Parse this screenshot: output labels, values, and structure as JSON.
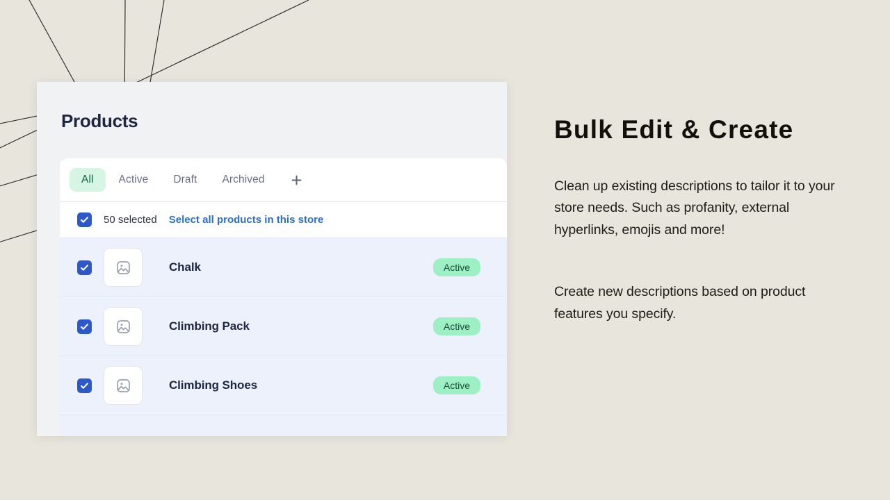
{
  "theme": {
    "page_background": "#e8e5dd",
    "card_background": "#f1f2f4",
    "panel_background": "#ffffff",
    "accent_blue": "#2c6ecb",
    "checkbox_blue": "#2c58c9",
    "badge_green_bg": "#9df0c4",
    "badge_green_text": "#1d4c3b",
    "tab_active_bg": "#d7f5e3",
    "tab_active_text": "#0e6245",
    "row_selected_bg": "#edf1fb",
    "heading_color": "#12100c",
    "title_color": "#1f2642"
  },
  "app": {
    "page_title": "Products",
    "tabs": [
      {
        "label": "All",
        "active": true
      },
      {
        "label": "Active",
        "active": false
      },
      {
        "label": "Draft",
        "active": false
      },
      {
        "label": "Archived",
        "active": false
      }
    ],
    "add_tab_icon": "plus-icon",
    "selection": {
      "checkbox_checked": true,
      "count_label": "50 selected",
      "select_all_link": "Select all products in this store"
    },
    "rows": [
      {
        "checked": true,
        "thumbnail_icon": "image-placeholder-icon",
        "name": "Chalk",
        "status": "Active"
      },
      {
        "checked": true,
        "thumbnail_icon": "image-placeholder-icon",
        "name": "Climbing Pack",
        "status": "Active"
      },
      {
        "checked": true,
        "thumbnail_icon": "image-placeholder-icon",
        "name": "Climbing Shoes",
        "status": "Active"
      }
    ]
  },
  "marketing": {
    "headline": "Bulk Edit & Create",
    "paragraph_1": "Clean up existing descriptions to tailor it to your store needs. Such as profanity, external hyperlinks, emojis and more!",
    "paragraph_2": "Create new descriptions based on product features you specify."
  }
}
